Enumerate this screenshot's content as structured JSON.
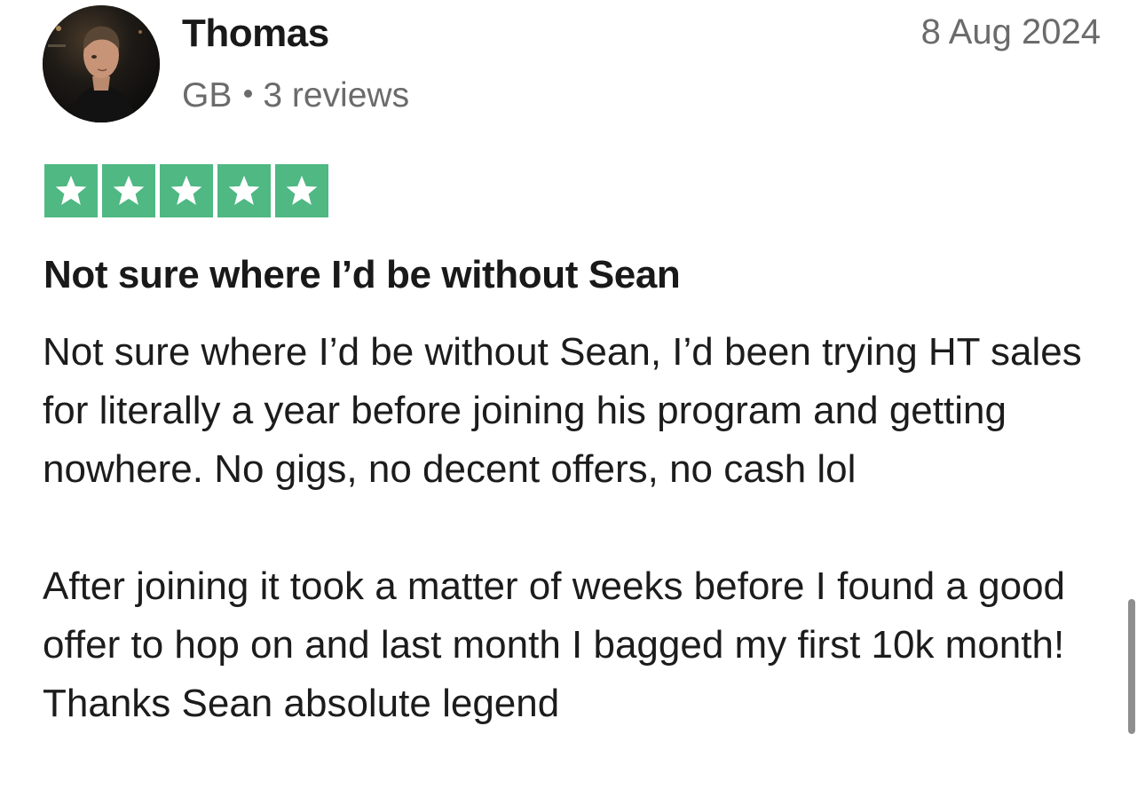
{
  "reviewer": {
    "name": "Thomas",
    "country": "GB",
    "review_count": "3 reviews"
  },
  "review": {
    "date": "8 Aug 2024",
    "rating": 5,
    "rating_max": 5,
    "star_color": "#4fb883",
    "title": "Not sure where I’d be without Sean",
    "paragraphs": [
      "Not sure where I’d be without Sean, I’d been trying HT sales for literally a year before joining his program and getting nowhere. No gigs, no decent offers, no cash lol",
      "After joining it took a matter of weeks before I found a good offer to hop on and last month I bagged my first 10k month! Thanks Sean absolute legend"
    ]
  },
  "icons": {
    "star": "star-icon",
    "avatar": "user-avatar-photo"
  }
}
